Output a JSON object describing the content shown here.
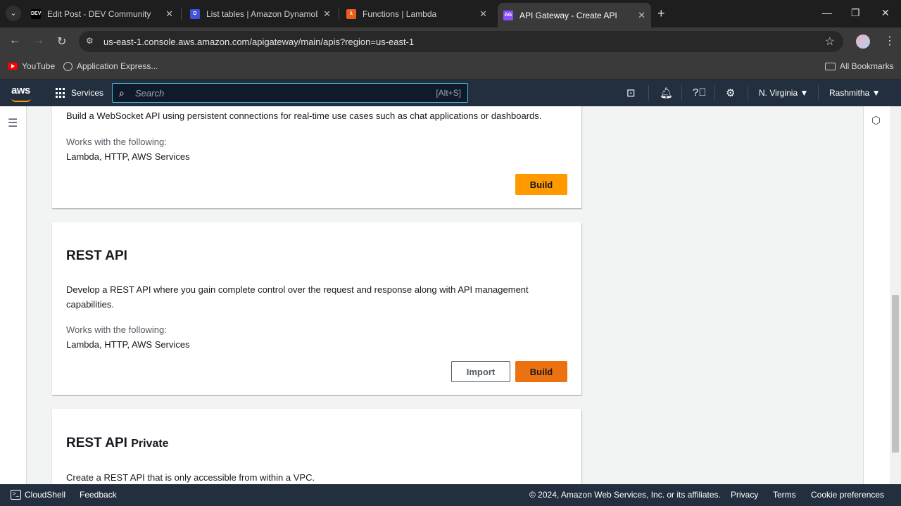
{
  "browser": {
    "tabs": [
      {
        "label": "Edit Post - DEV Community",
        "favicon": "DEV",
        "color": "#000000"
      },
      {
        "label": "List tables | Amazon DynamoDB",
        "favicon": "D",
        "color": "#4053d6"
      },
      {
        "label": "Functions | Lambda",
        "favicon": "λ",
        "color": "#e7601b"
      },
      {
        "label": "API Gateway - Create API",
        "favicon": "AG",
        "color": "#8c4fff"
      }
    ],
    "url": "us-east-1.console.aws.amazon.com/apigateway/main/apis?region=us-east-1",
    "bookmarks": [
      "YouTube",
      "Application Express..."
    ],
    "all_bookmarks": "All Bookmarks"
  },
  "aws_nav": {
    "logo": "aws",
    "services": "Services",
    "search_placeholder": "Search",
    "search_shortcut": "[Alt+S]",
    "region": "N. Virginia",
    "user": "Rashmitha"
  },
  "cards": {
    "websocket": {
      "description": "Build a WebSocket API using persistent connections for real-time use cases such as chat applications or dashboards.",
      "works_with_label": "Works with the following:",
      "works_with": "Lambda, HTTP, AWS Services",
      "build": "Build"
    },
    "rest": {
      "title": "REST API",
      "description": "Develop a REST API where you gain complete control over the request and response along with API management capabilities.",
      "works_with_label": "Works with the following:",
      "works_with": "Lambda, HTTP, AWS Services",
      "import": "Import",
      "build": "Build"
    },
    "rest_private": {
      "title": "REST API",
      "title_suffix": "Private",
      "description": "Create a REST API that is only accessible from within a VPC."
    }
  },
  "footer": {
    "cloudshell": "CloudShell",
    "feedback": "Feedback",
    "copyright": "© 2024, Amazon Web Services, Inc. or its affiliates.",
    "privacy": "Privacy",
    "terms": "Terms",
    "cookies": "Cookie preferences"
  },
  "colors": {
    "primary_button": "#ff9900",
    "primary_button_hover": "#ec7211",
    "aws_nav": "#232f3e"
  }
}
